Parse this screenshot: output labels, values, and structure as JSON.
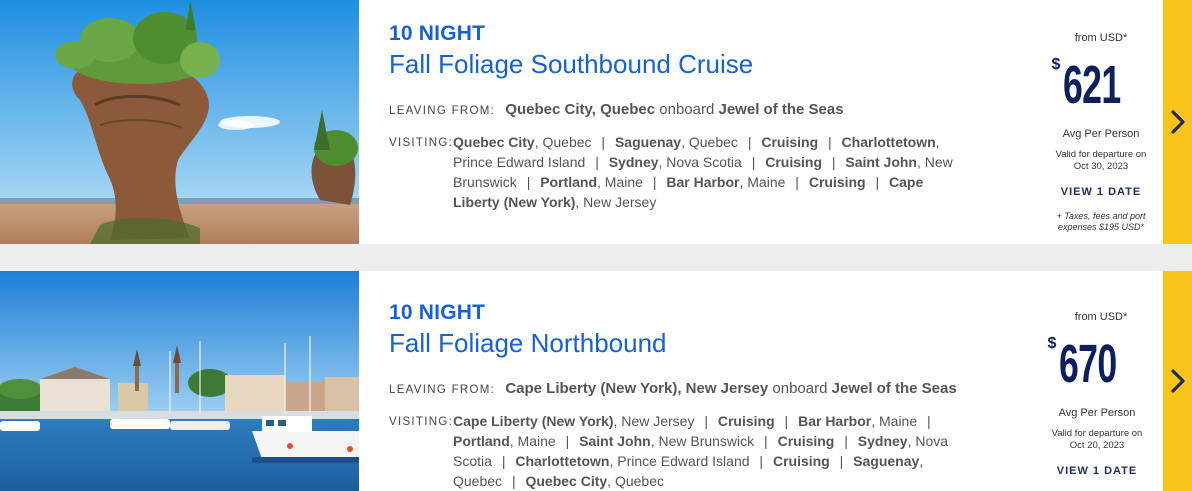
{
  "cruises": [
    {
      "nights": "10 NIGHT",
      "title": "Fall Foliage Southbound Cruise",
      "leaving_label": "LEAVING FROM:",
      "leaving_port": "Quebec City, Quebec",
      "onboard_word": "onboard",
      "ship": "Jewel of the Seas",
      "visiting_label": "VISITING:",
      "stops": [
        {
          "bold": "Quebec City",
          "rest": ", Quebec"
        },
        {
          "bold": "Saguenay",
          "rest": ", Quebec"
        },
        {
          "bold": "Cruising",
          "rest": ""
        },
        {
          "bold": "Charlottetown",
          "rest": ", Prince Edward Island"
        },
        {
          "bold": "Sydney",
          "rest": ", Nova Scotia"
        },
        {
          "bold": "Cruising",
          "rest": ""
        },
        {
          "bold": "Saint John",
          "rest": ", New Brunswick"
        },
        {
          "bold": "Portland",
          "rest": ", Maine"
        },
        {
          "bold": "Bar Harbor",
          "rest": ", Maine"
        },
        {
          "bold": "Cruising",
          "rest": ""
        },
        {
          "bold": "Cape Liberty (New York)",
          "rest": ", New Jersey"
        }
      ],
      "separator": "|",
      "from_label": "from USD*",
      "currency_symbol": "$",
      "price": "621",
      "avg_label": "Avg Per Person",
      "valid_line1": "Valid for departure on",
      "valid_line2": "Oct 30, 2023",
      "view_dates": "VIEW 1 DATE",
      "taxes_line1": "+ Taxes, fees and port",
      "taxes_line2": "expenses $195 USD*",
      "arrow_icon": "chevron-right-icon"
    },
    {
      "nights": "10 NIGHT",
      "title": "Fall Foliage Northbound",
      "leaving_label": "LEAVING FROM:",
      "leaving_port": "Cape Liberty (New York), New Jersey",
      "onboard_word": "onboard",
      "ship": "Jewel of the Seas",
      "visiting_label": "VISITING:",
      "stops": [
        {
          "bold": "Cape Liberty (New York)",
          "rest": ", New Jersey"
        },
        {
          "bold": "Cruising",
          "rest": ""
        },
        {
          "bold": "Bar Harbor",
          "rest": ", Maine"
        },
        {
          "bold": "Portland",
          "rest": ", Maine"
        },
        {
          "bold": "Saint John",
          "rest": ", New Brunswick"
        },
        {
          "bold": "Cruising",
          "rest": ""
        },
        {
          "bold": "Sydney",
          "rest": ", Nova Scotia"
        },
        {
          "bold": "Charlottetown",
          "rest": ", Prince Edward Island"
        },
        {
          "bold": "Cruising",
          "rest": ""
        },
        {
          "bold": "Saguenay",
          "rest": ", Quebec"
        },
        {
          "bold": "Quebec City",
          "rest": ", Quebec"
        }
      ],
      "separator": "|",
      "from_label": "from USD*",
      "currency_symbol": "$",
      "price": "670",
      "avg_label": "Avg Per Person",
      "valid_line1": "Valid for departure on",
      "valid_line2": "Oct 20, 2023",
      "view_dates": "VIEW 1 DATE",
      "arrow_icon": "chevron-right-icon"
    }
  ],
  "colors": {
    "link_blue": "#1561d6",
    "price_navy": "#0d1f5c",
    "arrow_yellow": "#fbc41b"
  }
}
